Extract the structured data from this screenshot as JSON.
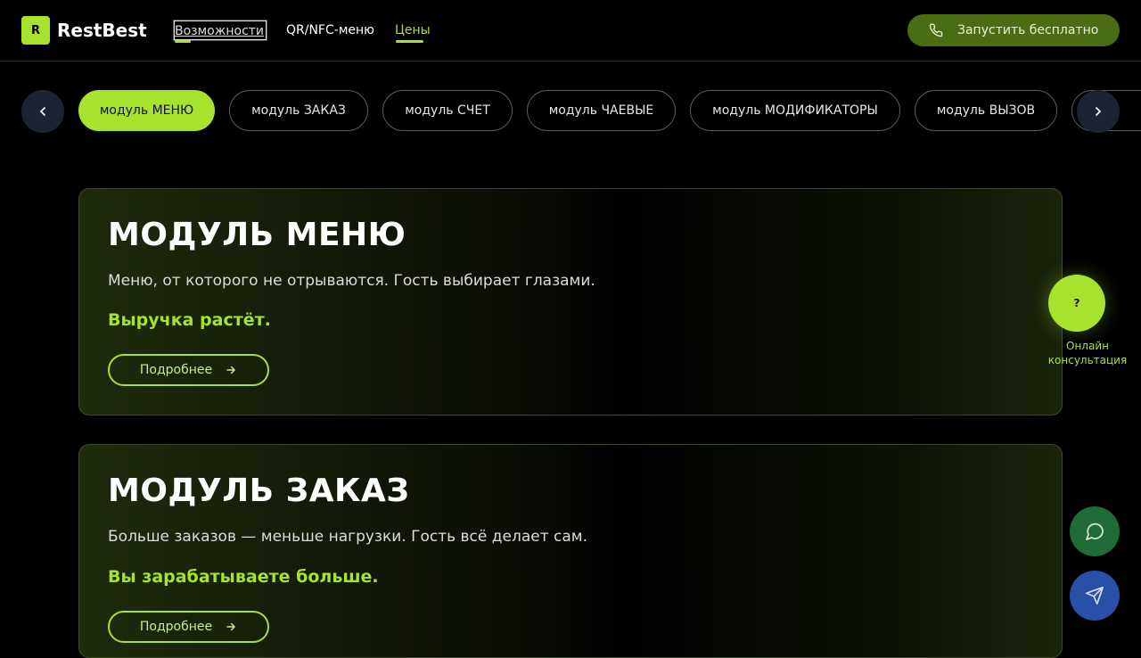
{
  "header": {
    "logo_letter": "R",
    "logo_text": "RestBest",
    "nav": {
      "features": "Возможности",
      "qr_nfc": "QR/NFC-меню",
      "prices": "Цены"
    },
    "cta_label": "Запустить бесплатно",
    "colors": {
      "accent": "#a6e22e",
      "cta_bg": "#4a6c13"
    }
  },
  "tabs": {
    "items": [
      {
        "label": "модуль МЕНЮ",
        "active": true
      },
      {
        "label": "модуль ЗАКАЗ",
        "active": false
      },
      {
        "label": "модуль СЧЕТ",
        "active": false
      },
      {
        "label": "модуль ЧАЕВЫЕ",
        "active": false
      },
      {
        "label": "модуль МОДИФИКАТОРЫ",
        "active": false
      },
      {
        "label": "модуль ВЫЗОВ",
        "active": false
      }
    ],
    "prev_icon": "chevron-left-icon",
    "next_icon": "chevron-right-icon"
  },
  "cards": [
    {
      "title": "МОДУЛЬ МЕНЮ",
      "description": "Меню, от которого не отрываются. Гость выбирает глазами.",
      "accent": "Выручка растёт.",
      "button": "Подробнее"
    },
    {
      "title": "МОДУЛЬ ЗАКАЗ",
      "description": "Больше заказов — меньше нагрузки. Гость всё делает сам.",
      "accent": "Вы зарабатываете больше.",
      "button": "Подробнее"
    }
  ],
  "floating": {
    "consult_icon": "?",
    "consult_label": "Онлайн консультация",
    "chat_icon": "chat-bubble-icon",
    "send_icon": "paper-plane-icon"
  }
}
